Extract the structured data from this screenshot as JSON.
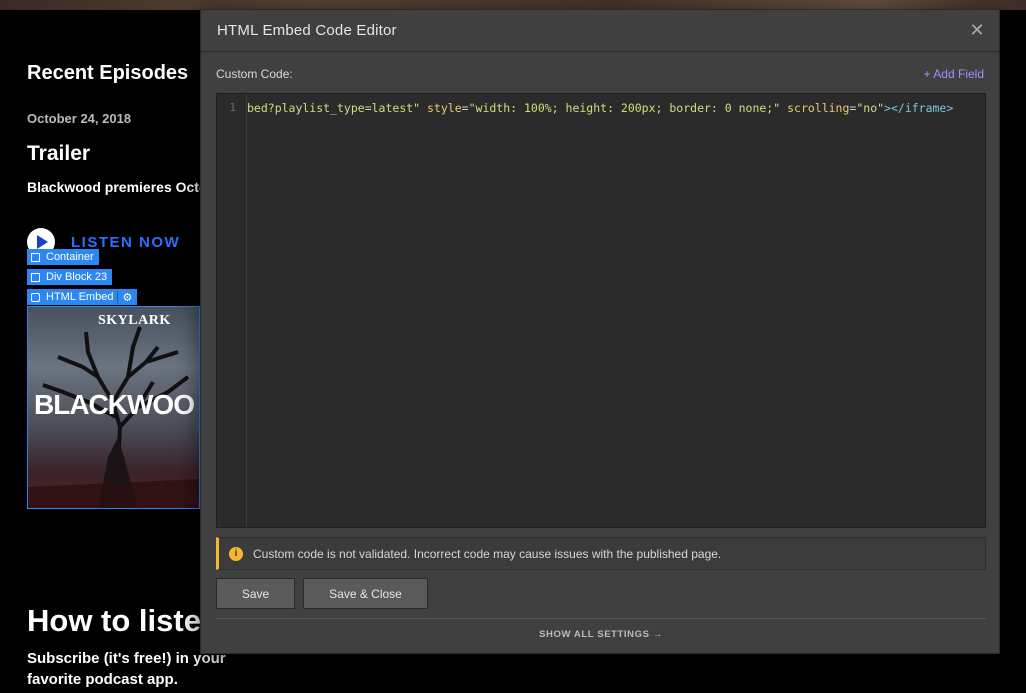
{
  "page": {
    "section_title": "Recent Episodes",
    "episode": {
      "date": "October 24, 2018",
      "title": "Trailer",
      "description": "Blackwood premieres Octob",
      "listen_label": "LISTEN NOW"
    },
    "designer_tags": {
      "container": "Container",
      "div_block": "Div Block 23",
      "html_embed": "HTML Embed"
    },
    "artwork": {
      "brand": "SKYLARK",
      "show_name": "BLACKWOO"
    },
    "how_to_title": "How to lister",
    "how_to_desc": "Subscribe (it's free!) in your favorite podcast app."
  },
  "modal": {
    "title": "HTML Embed Code Editor",
    "close_icon": "close-icon",
    "field_label": "Custom Code:",
    "add_field_label": "+ Add Field",
    "editor": {
      "line_number": "1",
      "tokens": {
        "t1": "bed?playlist_type=latest\"",
        "t2": " ",
        "t3": "style",
        "t4": "=",
        "t5": "\"width: 100%; height: 200px; border: 0 none;\"",
        "t6": " ",
        "t7": "scrolling",
        "t8": "=",
        "t9": "\"no\"",
        "t10": "></iframe>"
      }
    },
    "warning_text": "Custom code is not validated. Incorrect code may cause issues with the published page.",
    "save_label": "Save",
    "save_close_label": "Save & Close",
    "show_all_label": "SHOW ALL SETTINGS",
    "colors": {
      "accent_link": "#a48dff",
      "warning": "#f5b82e",
      "designer_blue": "#2d87f0"
    }
  }
}
